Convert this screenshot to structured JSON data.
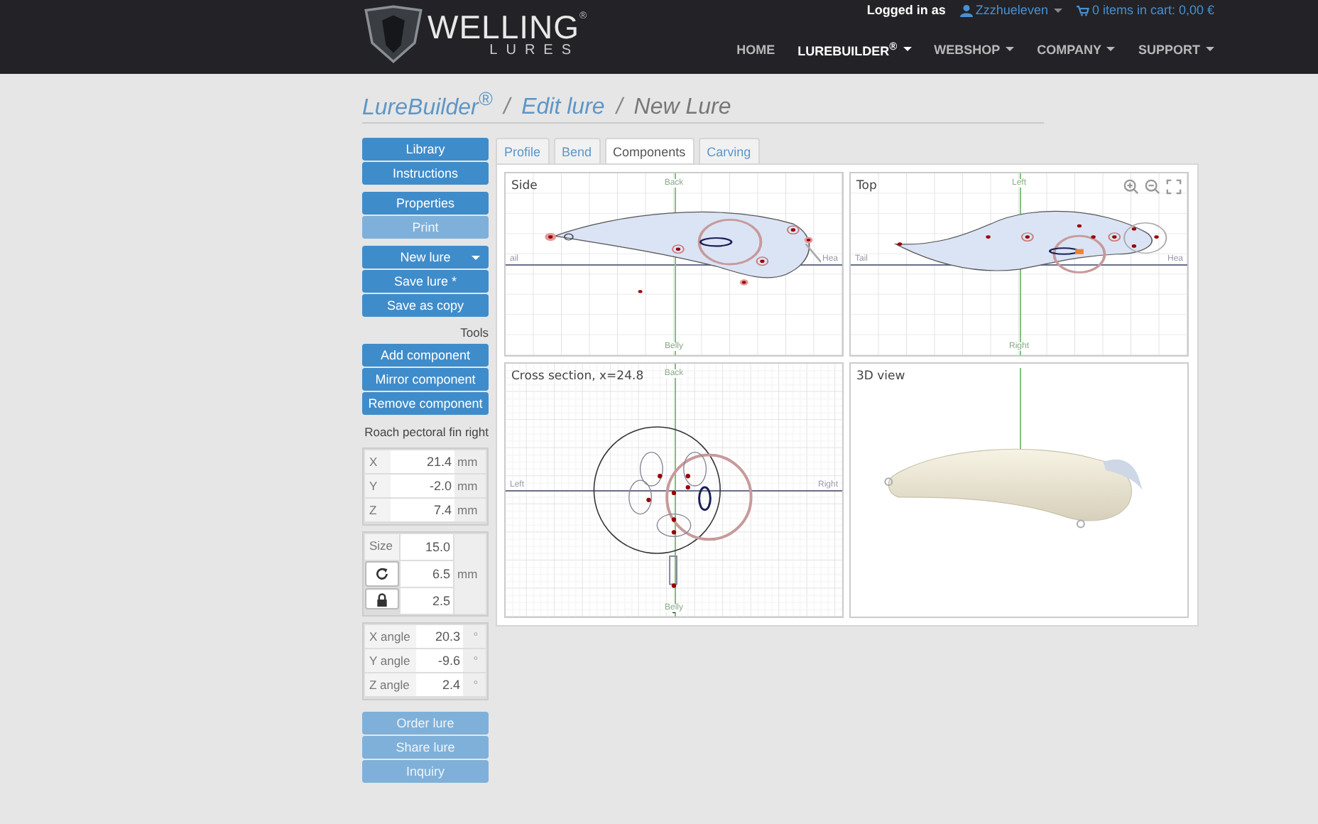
{
  "header": {
    "logo": {
      "name": "WELLING",
      "sub": "LURES",
      "mark": "®"
    },
    "user_bar": {
      "label": "Logged in as",
      "user": "Zzzhueleven",
      "cart": "0 items in cart: 0,00 €"
    },
    "nav": [
      {
        "label": "HOME",
        "selected": false,
        "dropdown": false
      },
      {
        "label": "LUREBUILDER$^{®}$",
        "selected": true,
        "dropdown": true
      },
      {
        "label": "WEBSHOP",
        "selected": false,
        "dropdown": true
      },
      {
        "label": "COMPANY",
        "selected": false,
        "dropdown": true
      },
      {
        "label": "SUPPORT",
        "selected": false,
        "dropdown": true
      }
    ]
  },
  "breadcrumb": {
    "separator": "/",
    "items": [
      "LureBuilder$^{®}$",
      "Edit lure",
      "New Lure"
    ]
  },
  "sidebar": {
    "nav_groups": [
      [
        {
          "label": "Library",
          "disabled": false,
          "dropdown": false
        },
        {
          "label": "Instructions",
          "disabled": false,
          "dropdown": false
        }
      ],
      [
        {
          "label": "Properties",
          "disabled": false,
          "dropdown": false
        },
        {
          "label": "Print",
          "disabled": true,
          "dropdown": false
        }
      ],
      [
        {
          "label": "New lure",
          "disabled": false,
          "dropdown": true
        },
        {
          "label": "Save lure *",
          "disabled": false,
          "dropdown": false
        },
        {
          "label": "Save as copy",
          "disabled": false,
          "dropdown": false
        }
      ]
    ],
    "tools_heading": "Tools",
    "tool_buttons": [
      {
        "label": "Add component",
        "disabled": false,
        "dropdown": false
      },
      {
        "label": "Mirror component",
        "disabled": false,
        "dropdown": false
      },
      {
        "label": "Remove component",
        "disabled": false,
        "dropdown": false
      }
    ],
    "component_name": "Roach pectoral fin right",
    "position": [
      {
        "label": "X",
        "value": "21.4",
        "unit": "mm"
      },
      {
        "label": "Y",
        "value": "-2.0",
        "unit": "mm"
      },
      {
        "label": "Z",
        "value": "7.4",
        "unit": "mm"
      }
    ],
    "size": {
      "label": "Size",
      "values": [
        "15.0",
        "6.5",
        "2.5"
      ],
      "unit": "mm"
    },
    "angles": [
      {
        "label": "X angle",
        "value": "20.3",
        "unit": "°"
      },
      {
        "label": "Y angle",
        "value": "-9.6",
        "unit": "°"
      },
      {
        "label": "Z angle",
        "value": "2.4",
        "unit": "°"
      }
    ],
    "action_buttons": [
      {
        "label": "Order lure",
        "disabled": true,
        "dropdown": false
      },
      {
        "label": "Share lure",
        "disabled": true,
        "dropdown": false
      },
      {
        "label": "Inquiry",
        "disabled": true,
        "dropdown": false
      }
    ]
  },
  "tabs": [
    {
      "label": "Profile",
      "selected": false
    },
    {
      "label": "Bend",
      "selected": false
    },
    {
      "label": "Components",
      "selected": true
    },
    {
      "label": "Carving",
      "selected": false
    }
  ],
  "views": [
    {
      "kind": "side",
      "title": "Side",
      "axes": {
        "top": "Back",
        "bottom": "Belly",
        "left": "ail",
        "right": "Hea"
      }
    },
    {
      "kind": "top",
      "title": "Top",
      "axes": {
        "top": "Left",
        "bottom": "Right",
        "left": "Tail",
        "right": "Hea"
      }
    },
    {
      "kind": "cross",
      "title": "Cross section, x=24.8",
      "axes": {
        "top": "Back",
        "bottom": "Belly",
        "left": "Left",
        "right": "Right"
      }
    },
    {
      "kind": "render",
      "title": "3D view"
    }
  ]
}
